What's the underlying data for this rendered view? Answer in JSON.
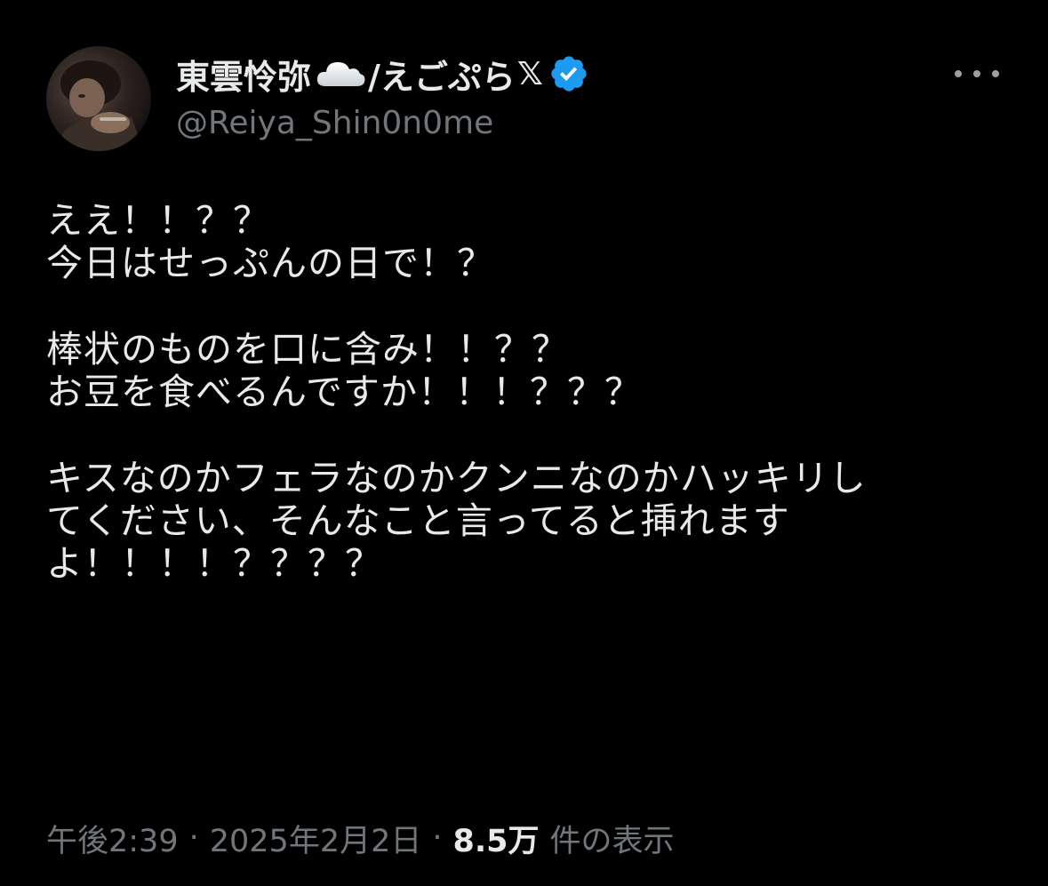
{
  "author": {
    "display_name": "東雲怜弥",
    "name_suffix": "/えごぷら",
    "x_glyph": "𝕏",
    "handle": "@Reiya_Shin0n0me",
    "avatar_icon": "profile-photo",
    "name_emoji_icon": "cloud-icon",
    "badge_icon": "verified-badge-icon",
    "badge_color": "#1d9bf0"
  },
  "more_icon": "more-options-icon",
  "tweet": {
    "text": "ええ！！？？\n今日はせっぷんの日で！？\n\n棒状のものを口に含み！！？？\nお豆を食べるんですか！！！？？？\n\nキスなのかフェラなのかクンニなのかハッキリし\nてください、そんなこと言ってると挿れます\nよ！！！！？？？？"
  },
  "meta": {
    "time": "午後2:39",
    "separator": "·",
    "date": "2025年2月2日",
    "views_count": "8.5万",
    "views_label": "件の表示"
  },
  "colors": {
    "background": "#000000",
    "text_primary": "#e7e9ea",
    "text_secondary": "#71767b",
    "accent": "#1d9bf0"
  }
}
